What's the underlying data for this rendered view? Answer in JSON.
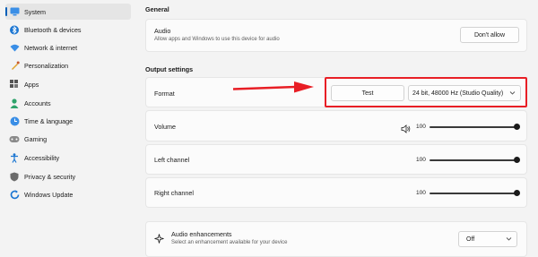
{
  "colors": {
    "accent": "#005fb8",
    "highlight_red": "#e81e25"
  },
  "sidebar": {
    "items": [
      {
        "label": "System",
        "icon": "monitor-icon",
        "selected": true
      },
      {
        "label": "Bluetooth & devices",
        "icon": "bluetooth-icon",
        "selected": false
      },
      {
        "label": "Network & internet",
        "icon": "wifi-icon",
        "selected": false
      },
      {
        "label": "Personalization",
        "icon": "paintbrush-icon",
        "selected": false
      },
      {
        "label": "Apps",
        "icon": "apps-icon",
        "selected": false
      },
      {
        "label": "Accounts",
        "icon": "person-icon",
        "selected": false
      },
      {
        "label": "Time & language",
        "icon": "globe-clock-icon",
        "selected": false
      },
      {
        "label": "Gaming",
        "icon": "gamepad-icon",
        "selected": false
      },
      {
        "label": "Accessibility",
        "icon": "accessibility-icon",
        "selected": false
      },
      {
        "label": "Privacy & security",
        "icon": "shield-icon",
        "selected": false
      },
      {
        "label": "Windows Update",
        "icon": "update-icon",
        "selected": false
      }
    ]
  },
  "general": {
    "title": "General",
    "audio": {
      "label": "Audio",
      "description": "Allow apps and Windows to use this device for audio",
      "button": "Don't allow"
    }
  },
  "output": {
    "title": "Output settings",
    "format": {
      "label": "Format",
      "test_button": "Test",
      "selected_format": "24 bit, 48000 Hz (Studio Quality)"
    },
    "volume": {
      "label": "Volume",
      "value": "100",
      "level": 1.0
    },
    "left_channel": {
      "label": "Left channel",
      "value": "100",
      "level": 1.0
    },
    "right_channel": {
      "label": "Right channel",
      "value": "100",
      "level": 1.0
    }
  },
  "enhancements": {
    "label": "Audio enhancements",
    "description": "Select an enhancement available for your device",
    "selected": "Off"
  }
}
